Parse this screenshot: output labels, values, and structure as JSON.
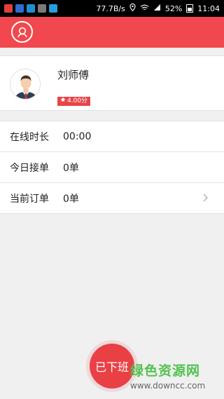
{
  "status_bar": {
    "speed": "77.7B/s",
    "battery": "52%",
    "time": "11:04",
    "app_icon_colors": [
      "#e0403a",
      "#2f6ccf",
      "#1f8fd0",
      "#7a7a7a",
      "#2a9cdc"
    ]
  },
  "header": {
    "bg_color": "#f0484e",
    "avatar_icon": "user-avatar-icon"
  },
  "profile": {
    "name": "刘师傅",
    "rating": "4.00分",
    "rating_icon": "star-icon",
    "badge_color": "#e74448"
  },
  "stats": [
    {
      "label": "在线时长",
      "value": "00:00",
      "has_chevron": false
    },
    {
      "label": "今日接单",
      "value": "0单",
      "has_chevron": false
    },
    {
      "label": "当前订单",
      "value": "0单",
      "has_chevron": true
    }
  ],
  "off_duty_button": {
    "label": "已下班",
    "color": "#e94045"
  },
  "watermark": {
    "title": "绿色资源网",
    "url": "www.downcc.com"
  }
}
